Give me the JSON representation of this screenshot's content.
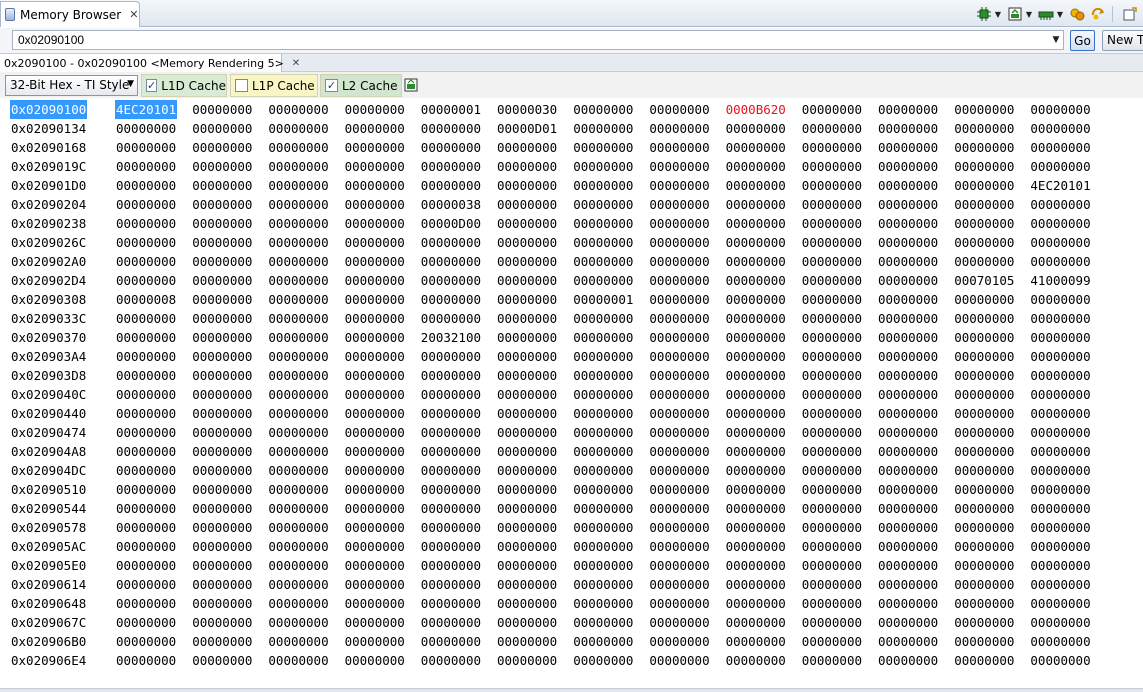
{
  "view": {
    "title": "Memory Browser",
    "close_glyph": "✕"
  },
  "toolbar": {
    "icons": [
      "refresh-chip-icon",
      "load-memory-icon",
      "save-memory-icon",
      "fill-memory-icon",
      "connect-icon",
      "new-view-icon"
    ]
  },
  "address_bar": {
    "value": "0x02090100",
    "go_label": "Go",
    "new_tab_label": "New Tab"
  },
  "rendering_tab": {
    "label": "0x2090100 - 0x02090100 <Memory Rendering 5>",
    "close_glyph": "✕"
  },
  "format": {
    "selected": "32-Bit Hex - TI Style"
  },
  "caches": [
    {
      "label": "L1D Cache",
      "checked": true,
      "color": "#d7ecd2"
    },
    {
      "label": "L1P Cache",
      "checked": false,
      "color": "#f9f6c4"
    },
    {
      "label": "L2 Cache",
      "checked": true,
      "color": "#d2e6cf"
    }
  ],
  "memory": {
    "selected_address": "0x02090100",
    "selection_color": "#3399ff",
    "changed_color": "#e8141b",
    "rows": [
      {
        "addr": "0x02090100",
        "vals": [
          "4EC20101",
          "00000000",
          "00000000",
          "00000000",
          "00000001",
          "00000030",
          "00000000",
          "00000000",
          "0000B620",
          "00000000",
          "00000000",
          "00000000",
          "00000000"
        ],
        "sel": [
          0
        ],
        "changed": [
          8
        ]
      },
      {
        "addr": "0x02090134",
        "vals": [
          "00000000",
          "00000000",
          "00000000",
          "00000000",
          "00000000",
          "00000D01",
          "00000000",
          "00000000",
          "00000000",
          "00000000",
          "00000000",
          "00000000",
          "00000000"
        ]
      },
      {
        "addr": "0x02090168",
        "vals": [
          "00000000",
          "00000000",
          "00000000",
          "00000000",
          "00000000",
          "00000000",
          "00000000",
          "00000000",
          "00000000",
          "00000000",
          "00000000",
          "00000000",
          "00000000"
        ]
      },
      {
        "addr": "0x0209019C",
        "vals": [
          "00000000",
          "00000000",
          "00000000",
          "00000000",
          "00000000",
          "00000000",
          "00000000",
          "00000000",
          "00000000",
          "00000000",
          "00000000",
          "00000000",
          "00000000"
        ]
      },
      {
        "addr": "0x020901D0",
        "vals": [
          "00000000",
          "00000000",
          "00000000",
          "00000000",
          "00000000",
          "00000000",
          "00000000",
          "00000000",
          "00000000",
          "00000000",
          "00000000",
          "00000000",
          "4EC20101"
        ]
      },
      {
        "addr": "0x02090204",
        "vals": [
          "00000000",
          "00000000",
          "00000000",
          "00000000",
          "00000038",
          "00000000",
          "00000000",
          "00000000",
          "00000000",
          "00000000",
          "00000000",
          "00000000",
          "00000000"
        ]
      },
      {
        "addr": "0x02090238",
        "vals": [
          "00000000",
          "00000000",
          "00000000",
          "00000000",
          "00000D00",
          "00000000",
          "00000000",
          "00000000",
          "00000000",
          "00000000",
          "00000000",
          "00000000",
          "00000000"
        ]
      },
      {
        "addr": "0x0209026C",
        "vals": [
          "00000000",
          "00000000",
          "00000000",
          "00000000",
          "00000000",
          "00000000",
          "00000000",
          "00000000",
          "00000000",
          "00000000",
          "00000000",
          "00000000",
          "00000000"
        ]
      },
      {
        "addr": "0x020902A0",
        "vals": [
          "00000000",
          "00000000",
          "00000000",
          "00000000",
          "00000000",
          "00000000",
          "00000000",
          "00000000",
          "00000000",
          "00000000",
          "00000000",
          "00000000",
          "00000000"
        ]
      },
      {
        "addr": "0x020902D4",
        "vals": [
          "00000000",
          "00000000",
          "00000000",
          "00000000",
          "00000000",
          "00000000",
          "00000000",
          "00000000",
          "00000000",
          "00000000",
          "00000000",
          "00070105",
          "41000099"
        ]
      },
      {
        "addr": "0x02090308",
        "vals": [
          "00000008",
          "00000000",
          "00000000",
          "00000000",
          "00000000",
          "00000000",
          "00000001",
          "00000000",
          "00000000",
          "00000000",
          "00000000",
          "00000000",
          "00000000"
        ]
      },
      {
        "addr": "0x0209033C",
        "vals": [
          "00000000",
          "00000000",
          "00000000",
          "00000000",
          "00000000",
          "00000000",
          "00000000",
          "00000000",
          "00000000",
          "00000000",
          "00000000",
          "00000000",
          "00000000"
        ]
      },
      {
        "addr": "0x02090370",
        "vals": [
          "00000000",
          "00000000",
          "00000000",
          "00000000",
          "20032100",
          "00000000",
          "00000000",
          "00000000",
          "00000000",
          "00000000",
          "00000000",
          "00000000",
          "00000000"
        ]
      },
      {
        "addr": "0x020903A4",
        "vals": [
          "00000000",
          "00000000",
          "00000000",
          "00000000",
          "00000000",
          "00000000",
          "00000000",
          "00000000",
          "00000000",
          "00000000",
          "00000000",
          "00000000",
          "00000000"
        ]
      },
      {
        "addr": "0x020903D8",
        "vals": [
          "00000000",
          "00000000",
          "00000000",
          "00000000",
          "00000000",
          "00000000",
          "00000000",
          "00000000",
          "00000000",
          "00000000",
          "00000000",
          "00000000",
          "00000000"
        ]
      },
      {
        "addr": "0x0209040C",
        "vals": [
          "00000000",
          "00000000",
          "00000000",
          "00000000",
          "00000000",
          "00000000",
          "00000000",
          "00000000",
          "00000000",
          "00000000",
          "00000000",
          "00000000",
          "00000000"
        ]
      },
      {
        "addr": "0x02090440",
        "vals": [
          "00000000",
          "00000000",
          "00000000",
          "00000000",
          "00000000",
          "00000000",
          "00000000",
          "00000000",
          "00000000",
          "00000000",
          "00000000",
          "00000000",
          "00000000"
        ]
      },
      {
        "addr": "0x02090474",
        "vals": [
          "00000000",
          "00000000",
          "00000000",
          "00000000",
          "00000000",
          "00000000",
          "00000000",
          "00000000",
          "00000000",
          "00000000",
          "00000000",
          "00000000",
          "00000000"
        ]
      },
      {
        "addr": "0x020904A8",
        "vals": [
          "00000000",
          "00000000",
          "00000000",
          "00000000",
          "00000000",
          "00000000",
          "00000000",
          "00000000",
          "00000000",
          "00000000",
          "00000000",
          "00000000",
          "00000000"
        ]
      },
      {
        "addr": "0x020904DC",
        "vals": [
          "00000000",
          "00000000",
          "00000000",
          "00000000",
          "00000000",
          "00000000",
          "00000000",
          "00000000",
          "00000000",
          "00000000",
          "00000000",
          "00000000",
          "00000000"
        ]
      },
      {
        "addr": "0x02090510",
        "vals": [
          "00000000",
          "00000000",
          "00000000",
          "00000000",
          "00000000",
          "00000000",
          "00000000",
          "00000000",
          "00000000",
          "00000000",
          "00000000",
          "00000000",
          "00000000"
        ]
      },
      {
        "addr": "0x02090544",
        "vals": [
          "00000000",
          "00000000",
          "00000000",
          "00000000",
          "00000000",
          "00000000",
          "00000000",
          "00000000",
          "00000000",
          "00000000",
          "00000000",
          "00000000",
          "00000000"
        ]
      },
      {
        "addr": "0x02090578",
        "vals": [
          "00000000",
          "00000000",
          "00000000",
          "00000000",
          "00000000",
          "00000000",
          "00000000",
          "00000000",
          "00000000",
          "00000000",
          "00000000",
          "00000000",
          "00000000"
        ]
      },
      {
        "addr": "0x020905AC",
        "vals": [
          "00000000",
          "00000000",
          "00000000",
          "00000000",
          "00000000",
          "00000000",
          "00000000",
          "00000000",
          "00000000",
          "00000000",
          "00000000",
          "00000000",
          "00000000"
        ]
      },
      {
        "addr": "0x020905E0",
        "vals": [
          "00000000",
          "00000000",
          "00000000",
          "00000000",
          "00000000",
          "00000000",
          "00000000",
          "00000000",
          "00000000",
          "00000000",
          "00000000",
          "00000000",
          "00000000"
        ]
      },
      {
        "addr": "0x02090614",
        "vals": [
          "00000000",
          "00000000",
          "00000000",
          "00000000",
          "00000000",
          "00000000",
          "00000000",
          "00000000",
          "00000000",
          "00000000",
          "00000000",
          "00000000",
          "00000000"
        ]
      },
      {
        "addr": "0x02090648",
        "vals": [
          "00000000",
          "00000000",
          "00000000",
          "00000000",
          "00000000",
          "00000000",
          "00000000",
          "00000000",
          "00000000",
          "00000000",
          "00000000",
          "00000000",
          "00000000"
        ]
      },
      {
        "addr": "0x0209067C",
        "vals": [
          "00000000",
          "00000000",
          "00000000",
          "00000000",
          "00000000",
          "00000000",
          "00000000",
          "00000000",
          "00000000",
          "00000000",
          "00000000",
          "00000000",
          "00000000"
        ]
      },
      {
        "addr": "0x020906B0",
        "vals": [
          "00000000",
          "00000000",
          "00000000",
          "00000000",
          "00000000",
          "00000000",
          "00000000",
          "00000000",
          "00000000",
          "00000000",
          "00000000",
          "00000000",
          "00000000"
        ]
      },
      {
        "addr": "0x020906E4",
        "vals": [
          "00000000",
          "00000000",
          "00000000",
          "00000000",
          "00000000",
          "00000000",
          "00000000",
          "00000000",
          "00000000",
          "00000000",
          "00000000",
          "00000000",
          "00000000"
        ]
      }
    ]
  }
}
